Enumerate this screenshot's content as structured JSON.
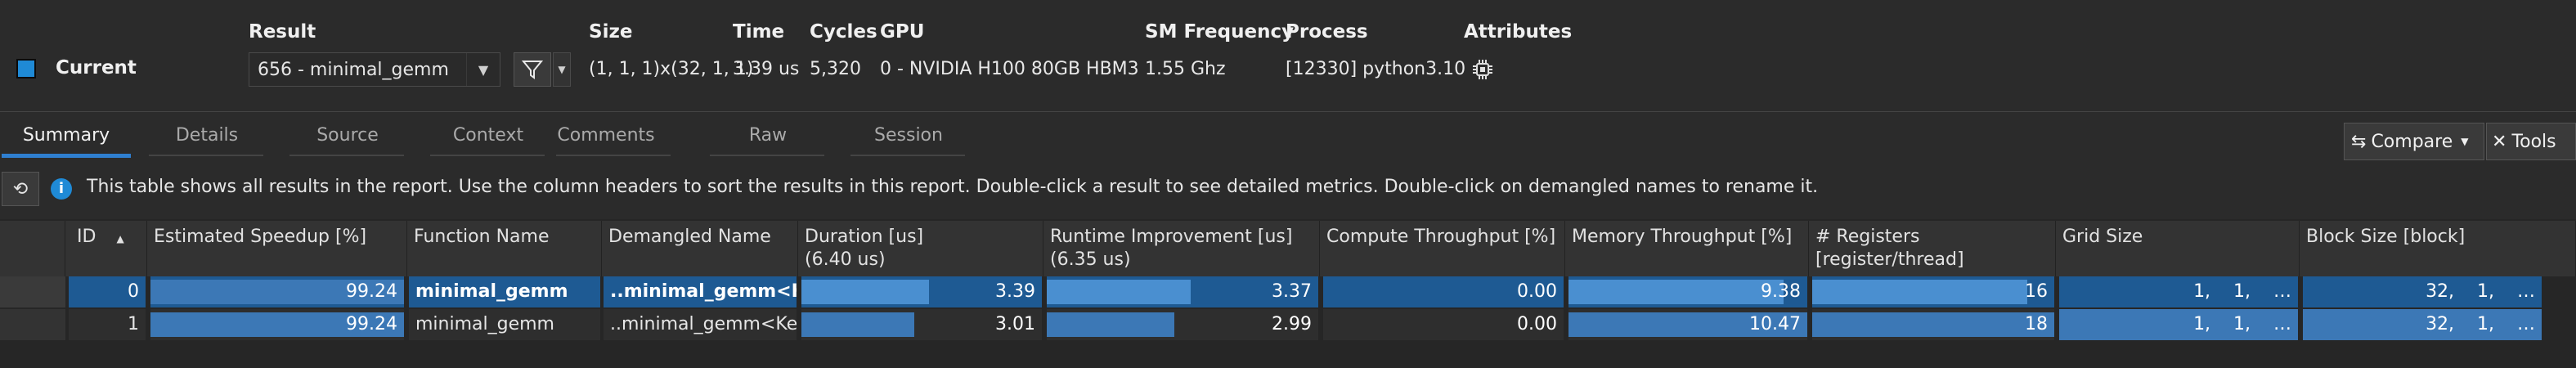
{
  "header": {
    "current_label": "Current",
    "result": {
      "label": "Result",
      "value": "656 - minimal_gemm"
    },
    "size": {
      "label": "Size",
      "value": "(1, 1, 1)x(32, 1, 1)"
    },
    "time": {
      "label": "Time",
      "value": "3.39 us"
    },
    "cycles": {
      "label": "Cycles",
      "value": "5,320"
    },
    "gpu": {
      "label": "GPU",
      "value": "0 - NVIDIA H100 80GB HBM3"
    },
    "sm_frequency": {
      "label": "SM Frequency",
      "value": "1.55 Ghz"
    },
    "process": {
      "label": "Process",
      "value": "[12330] python3.10"
    },
    "attributes": {
      "label": "Attributes"
    },
    "accent": "#1f8ad6"
  },
  "tabs": [
    {
      "label": "Summary",
      "active": true
    },
    {
      "label": "Details"
    },
    {
      "label": "Source"
    },
    {
      "label": "Context"
    },
    {
      "label": "Comments"
    },
    {
      "label": "Raw"
    },
    {
      "label": "Session"
    }
  ],
  "toolbar": {
    "compare_label": "Compare",
    "tools_label": "Tools"
  },
  "info": {
    "text": "This table shows all results in the report. Use the column headers to sort the results in this report. Double-click a result to see detailed metrics. Double-click on demangled names to rename it."
  },
  "table": {
    "columns": [
      {
        "line1": "ID",
        "line2": ""
      },
      {
        "line1": "Estimated Speedup [%]",
        "line2": ""
      },
      {
        "line1": "Function Name",
        "line2": ""
      },
      {
        "line1": "Demangled Name",
        "line2": ""
      },
      {
        "line1": "Duration [us]",
        "line2": "(6.40 us)"
      },
      {
        "line1": "Runtime Improvement [us]",
        "line2": "(6.35 us)"
      },
      {
        "line1": "Compute Throughput [%]",
        "line2": ""
      },
      {
        "line1": "Memory Throughput [%]",
        "line2": ""
      },
      {
        "line1": "# Registers [register/thread]",
        "line2": ""
      },
      {
        "line1": "Grid Size",
        "line2": ""
      },
      {
        "line1": "Block Size [block]",
        "line2": ""
      }
    ],
    "rows": [
      {
        "id": "0",
        "speedup": "99.24",
        "function": "minimal_gemm",
        "demangled": "..minimal_gemm<K…",
        "duration": "3.39",
        "runtime": "3.37",
        "compute": "0.00",
        "memory": "9.38",
        "registers": "16",
        "grid": "1,    1,    …",
        "block": "32,    1,    …",
        "fill": {
          "speedup": 1.0,
          "duration": 0.53,
          "runtime": 0.53,
          "compute": 0.0,
          "memory": 0.9,
          "registers": 0.89
        }
      },
      {
        "id": "1",
        "speedup": "99.24",
        "function": "minimal_gemm",
        "demangled": "..minimal_gemm<Ke…",
        "duration": "3.01",
        "runtime": "2.99",
        "compute": "0.00",
        "memory": "10.47",
        "registers": "18",
        "grid": "1,    1,    …",
        "block": "32,    1,    …",
        "fill": {
          "speedup": 1.0,
          "duration": 0.47,
          "runtime": 0.47,
          "compute": 0.0,
          "memory": 1.0,
          "registers": 1.0
        }
      }
    ]
  }
}
